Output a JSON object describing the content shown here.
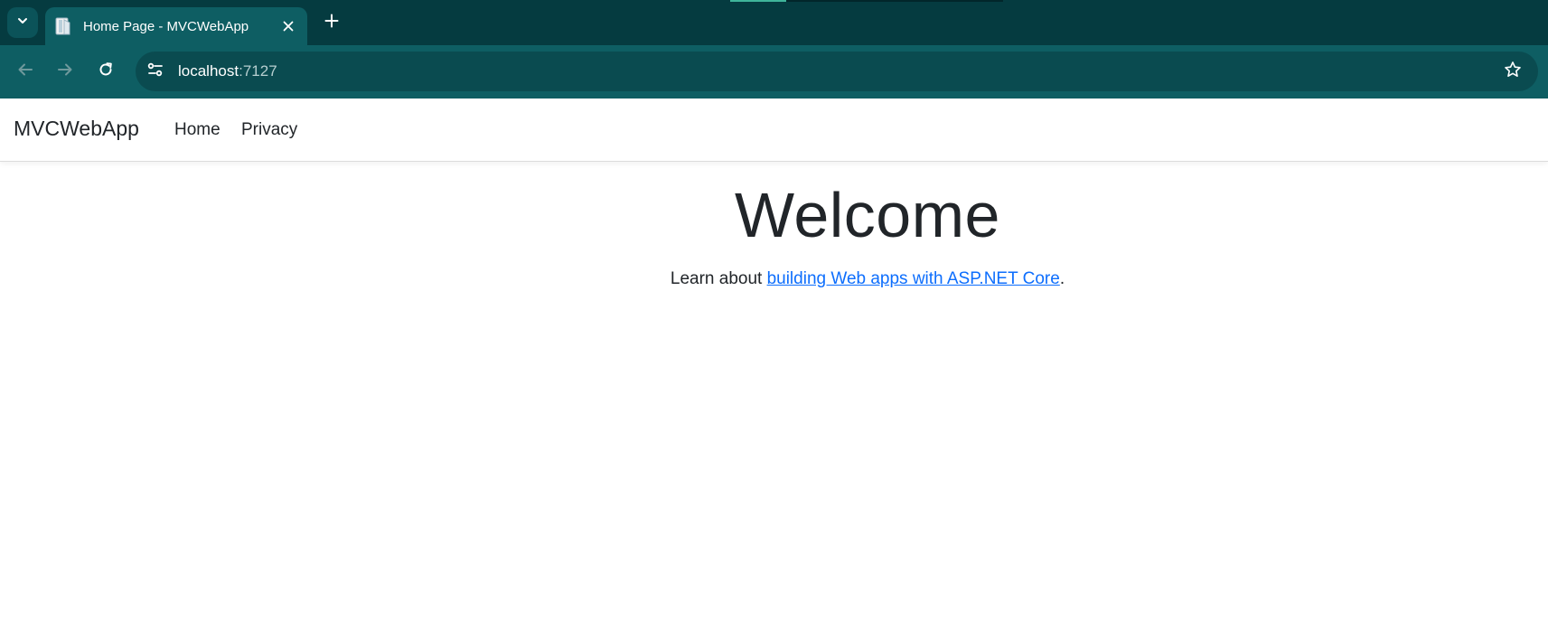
{
  "browser": {
    "tab": {
      "title": "Home Page - MVCWebApp"
    },
    "address": {
      "host": "localhost",
      "port": ":7127"
    },
    "colors": {
      "tabstrip": "#053b40",
      "toolbar": "#0e5e63",
      "omnibox": "#0a4b50"
    },
    "icons": {
      "tab_search": "chevron-down-icon",
      "tab_favicon": "page-icon",
      "tab_close": "close-icon",
      "new_tab": "plus-icon",
      "back": "arrow-left-icon",
      "forward": "arrow-right-icon",
      "reload": "reload-icon",
      "site_info": "tune-icon",
      "bookmark": "star-icon"
    }
  },
  "site": {
    "brand": "MVCWebApp",
    "nav": [
      {
        "label": "Home"
      },
      {
        "label": "Privacy"
      }
    ]
  },
  "main": {
    "heading": "Welcome",
    "lead_prefix": "Learn about ",
    "lead_link": "building Web apps with ASP.NET Core",
    "lead_suffix": ".",
    "link_color": "#0d6efd"
  }
}
